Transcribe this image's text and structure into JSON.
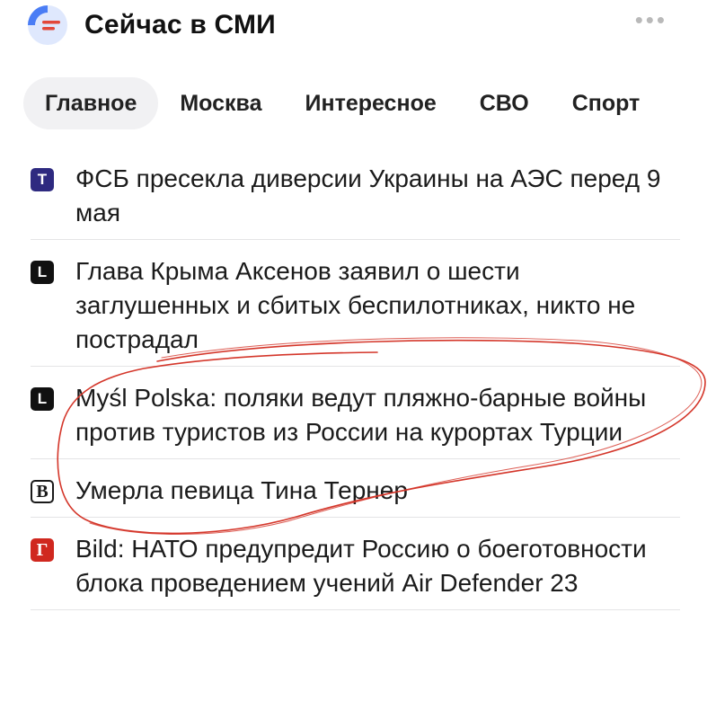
{
  "header": {
    "title": "Сейчас в СМИ",
    "more_icon": "•••"
  },
  "tabs": [
    {
      "label": "Главное",
      "active": true
    },
    {
      "label": "Москва",
      "active": false
    },
    {
      "label": "Интересное",
      "active": false
    },
    {
      "label": "СВО",
      "active": false
    },
    {
      "label": "Спорт",
      "active": false
    }
  ],
  "news": [
    {
      "source_icon": "Т",
      "source_color": "#2e2a80",
      "headline": "ФСБ пресекла диверсии Украины на АЭС перед 9 мая"
    },
    {
      "source_icon": "L",
      "source_color": "#111111",
      "headline": "Глава Крыма Аксенов заявил о шести заглушенных и сбитых беспилотниках, никто не пострадал"
    },
    {
      "source_icon": "L",
      "source_color": "#111111",
      "headline": "Myśl Polska: поляки ведут пляжно-барные войны против туристов из России на курортах Турции"
    },
    {
      "source_icon": "B",
      "source_color": "#1a1a1a",
      "headline": "Умерла певица Тина Тернер"
    },
    {
      "source_icon": "Г",
      "source_color": "#d0281f",
      "headline": "Bild: НАТО предупредит Россию о боеготовности блока проведением учений Air Defender 23"
    }
  ],
  "colors": {
    "accent_logo": "#4a7df5",
    "logo_lines": "#e2473a",
    "annotation": "#d4362a"
  }
}
